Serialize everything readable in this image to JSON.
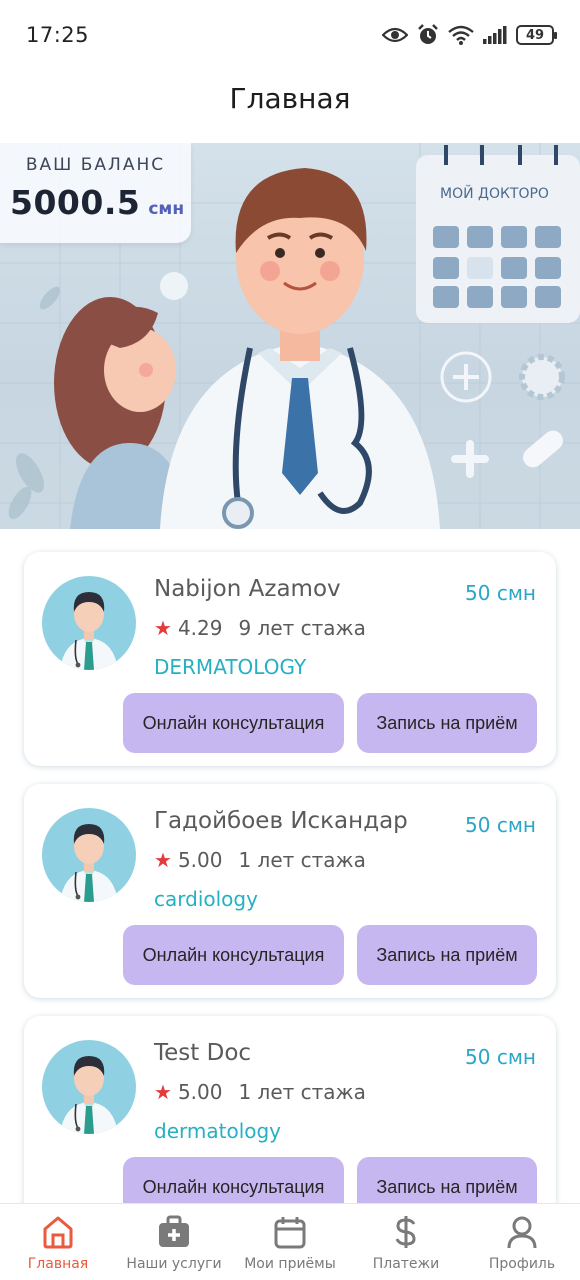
{
  "status_bar": {
    "time": "17:25",
    "battery": "49"
  },
  "header": {
    "title": "Главная"
  },
  "banner": {
    "balance_label": "ВАШ БАЛАНС",
    "balance_amount": "5000.5",
    "balance_currency": "смн",
    "calendar_title": "MOЙ ДОКТОРO"
  },
  "doctors": [
    {
      "name": "Nabijon Azamov",
      "price": "50 смн",
      "rating": "4.29",
      "experience": "9 лет стажа",
      "specialty": "DERMATOLOGY"
    },
    {
      "name": "Гадойбоев Искандар",
      "price": "50 смн",
      "rating": "5.00",
      "experience": "1 лет стажа",
      "specialty": "cardiology"
    },
    {
      "name": "Test Doc",
      "price": "50 смн",
      "rating": "5.00",
      "experience": "1 лет стажа",
      "specialty": "dermatology"
    }
  ],
  "actions": {
    "online": "Онлайн консультация",
    "appointment": "Запись на приём"
  },
  "nav": {
    "items": [
      {
        "label": "Главная",
        "icon": "home-icon"
      },
      {
        "label": "Наши услуги",
        "icon": "medkit-icon"
      },
      {
        "label": "Мои приёмы",
        "icon": "calendar-icon"
      },
      {
        "label": "Платежи",
        "icon": "dollar-icon"
      },
      {
        "label": "Профиль",
        "icon": "user-icon"
      }
    ],
    "active_color": "#ea5a3c",
    "inactive_color": "#7a7a7a"
  },
  "colors": {
    "price": "#2aa6c8",
    "specialty": "#25b1c2",
    "button": "#c7b7f0",
    "star": "#e23b3b"
  }
}
